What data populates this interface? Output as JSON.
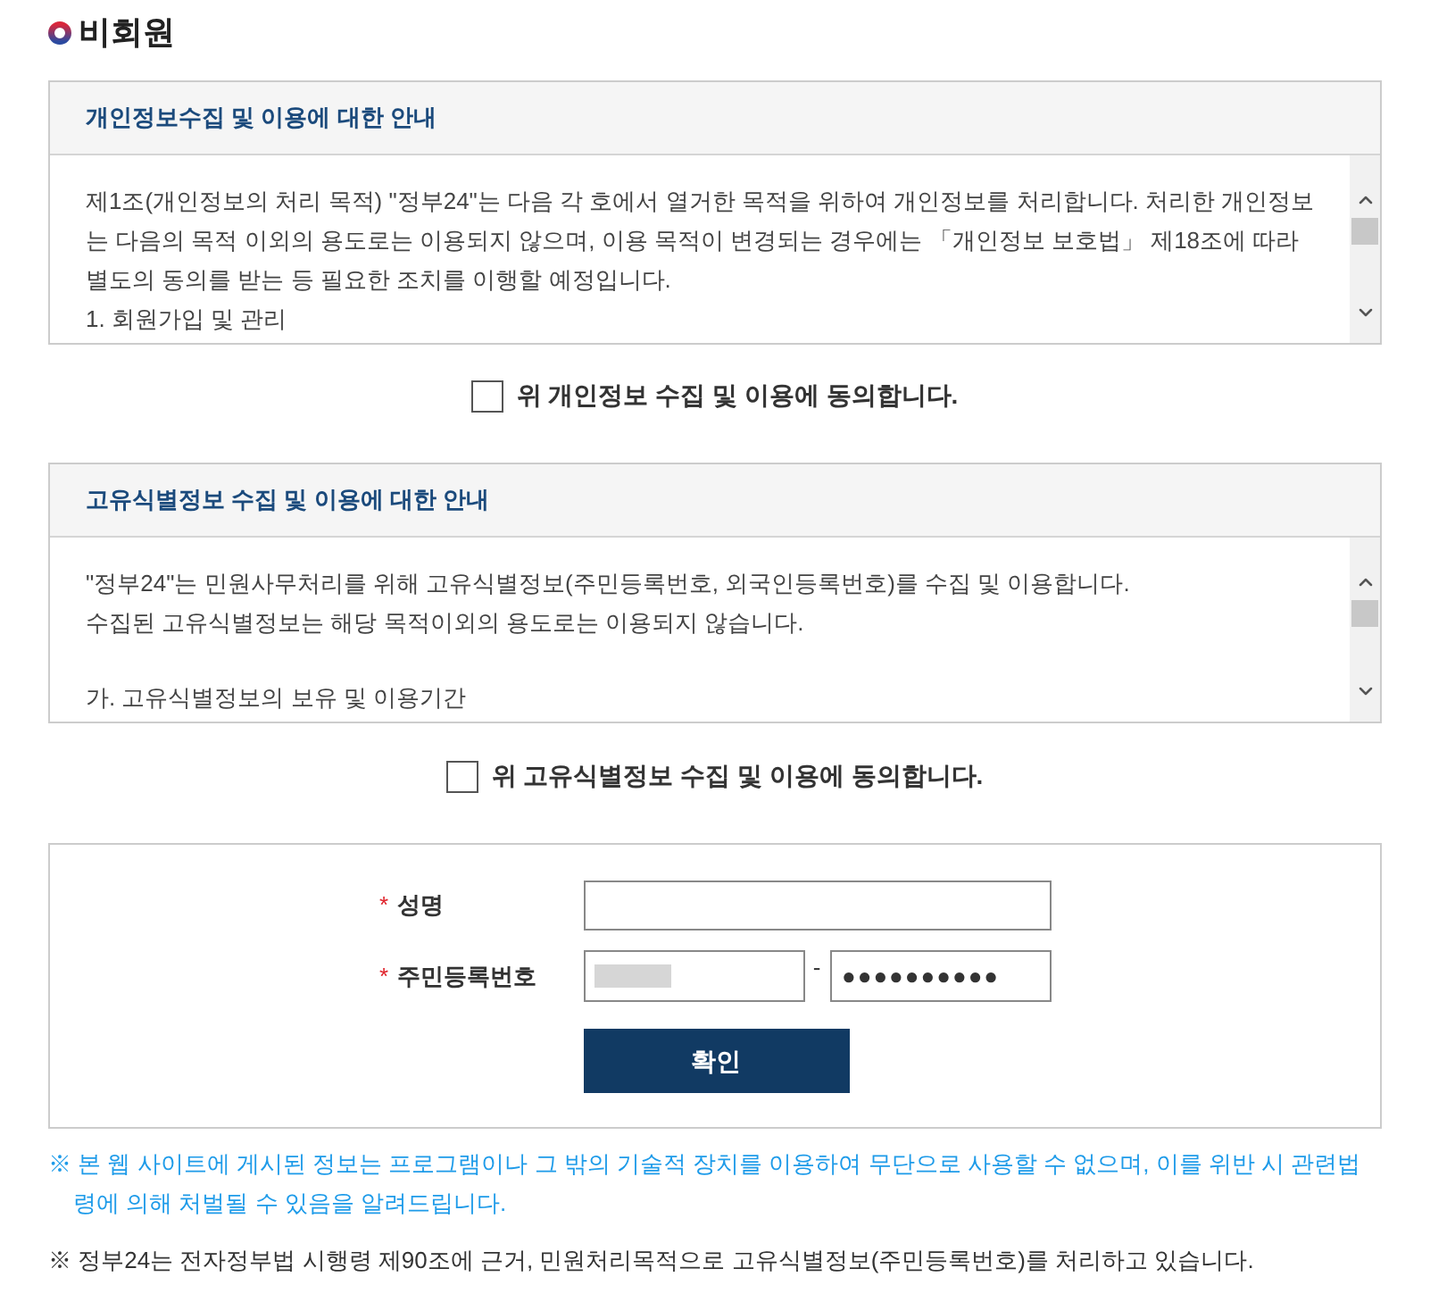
{
  "page_title": "비회원",
  "agreements": [
    {
      "title": "개인정보수집 및 이용에 대한 안내",
      "paragraphs": [
        [
          "제1조(개인정보의 처리 목적) \"정부24\"는 다음 각 호에서 열거한 목적을 위하여 개인정보를 처리합니다. 처리한 개인정보는 다음의 목적 이외의 용도로는 이용되지 않으며, 이용 목적이 변경되는 경우에는 「개인정보 보호법」 제18조에 따라 별도의 동의를 받는 등 필요한 조치를 이행할 예정입니다.",
          "1. 회원가입 및 관리"
        ]
      ],
      "consent": {
        "label": "위 개인정보 수집 및 이용에 동의합니다.",
        "checked": false
      }
    },
    {
      "title": "고유식별정보 수집 및 이용에 대한 안내",
      "paragraphs": [
        [
          "\"정부24\"는 민원사무처리를 위해 고유식별정보(주민등록번호, 외국인등록번호)를 수집 및 이용합니다.",
          "수집된 고유식별정보는 해당 목적이외의 용도로는 이용되지 않습니다."
        ],
        [
          "가. 고유식별정보의 보유 및 이용기간"
        ]
      ],
      "consent": {
        "label": "위 고유식별정보 수집 및 이용에 동의합니다.",
        "checked": false
      }
    }
  ],
  "form": {
    "fields": [
      {
        "kind": "single",
        "required_mark": "*",
        "label": "성명"
      },
      {
        "kind": "split",
        "required_mark": "*",
        "label": "주민등록번호",
        "first": {
          "redacted": true
        },
        "separator": "-",
        "second": {
          "value": "●●●●●●●●●●"
        }
      }
    ],
    "submit_button": "확인"
  },
  "notices": [
    {
      "kind": "warning",
      "text": "※ 본 웹 사이트에 게시된 정보는 프로그램이나 그 밖의 기술적 장치를 이용하여 무단으로 사용할 수 없으며, 이를 위반 시 관련법령에 의해 처벌될 수 있음을 알려드립니다."
    },
    {
      "kind": "info",
      "text": "※ 정부24는 전자정부법 시행령 제90조에 근거, 민원처리목적으로 고유식별정보(주민등록번호)를 처리하고 있습니다."
    }
  ]
}
